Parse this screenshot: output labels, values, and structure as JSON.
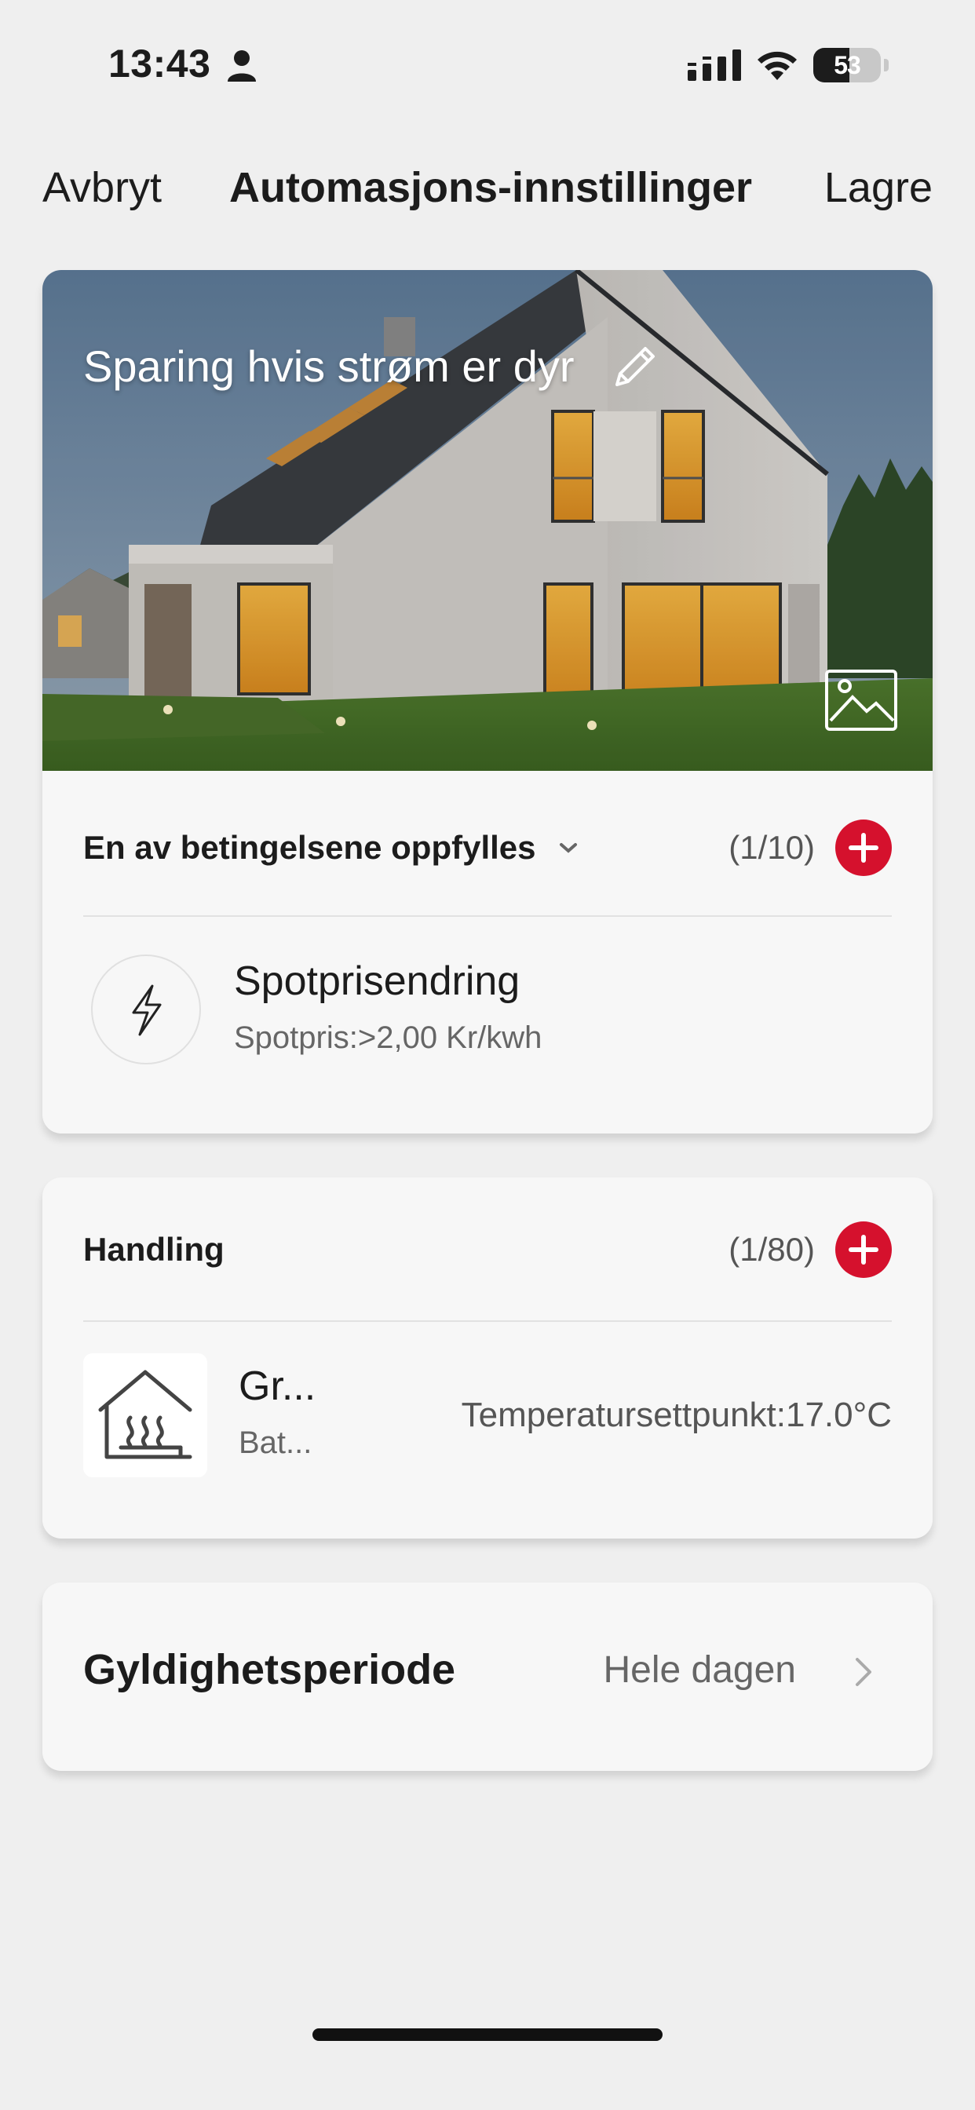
{
  "status_bar": {
    "time": "13:43",
    "battery_level": "53",
    "battery_percent": 53
  },
  "nav": {
    "cancel_label": "Avbryt",
    "title": "Automasjons-innstillinger",
    "save_label": "Lagre"
  },
  "hero": {
    "title": "Sparing hvis strøm er dyr",
    "edit_icon": "pencil-icon",
    "image_icon": "image-icon"
  },
  "conditions": {
    "label": "En av betingelsene oppfylles",
    "count": "(1/10)",
    "items": [
      {
        "title": "Spotprisendring",
        "subtitle": "Spotpris:>2,00 Kr/kwh",
        "icon": "lightning-icon"
      }
    ]
  },
  "actions": {
    "label": "Handling",
    "count": "(1/80)",
    "items": [
      {
        "title": "Gr...",
        "subtitle": "Bat...",
        "value": "Temperatursettpunkt:17.0°C",
        "icon": "floor-heating-icon"
      }
    ]
  },
  "validity": {
    "label": "Gyldighetsperiode",
    "value": "Hele dagen"
  },
  "colors": {
    "accent": "#d5112d",
    "background": "#efefef",
    "card": "#f7f7f7"
  }
}
